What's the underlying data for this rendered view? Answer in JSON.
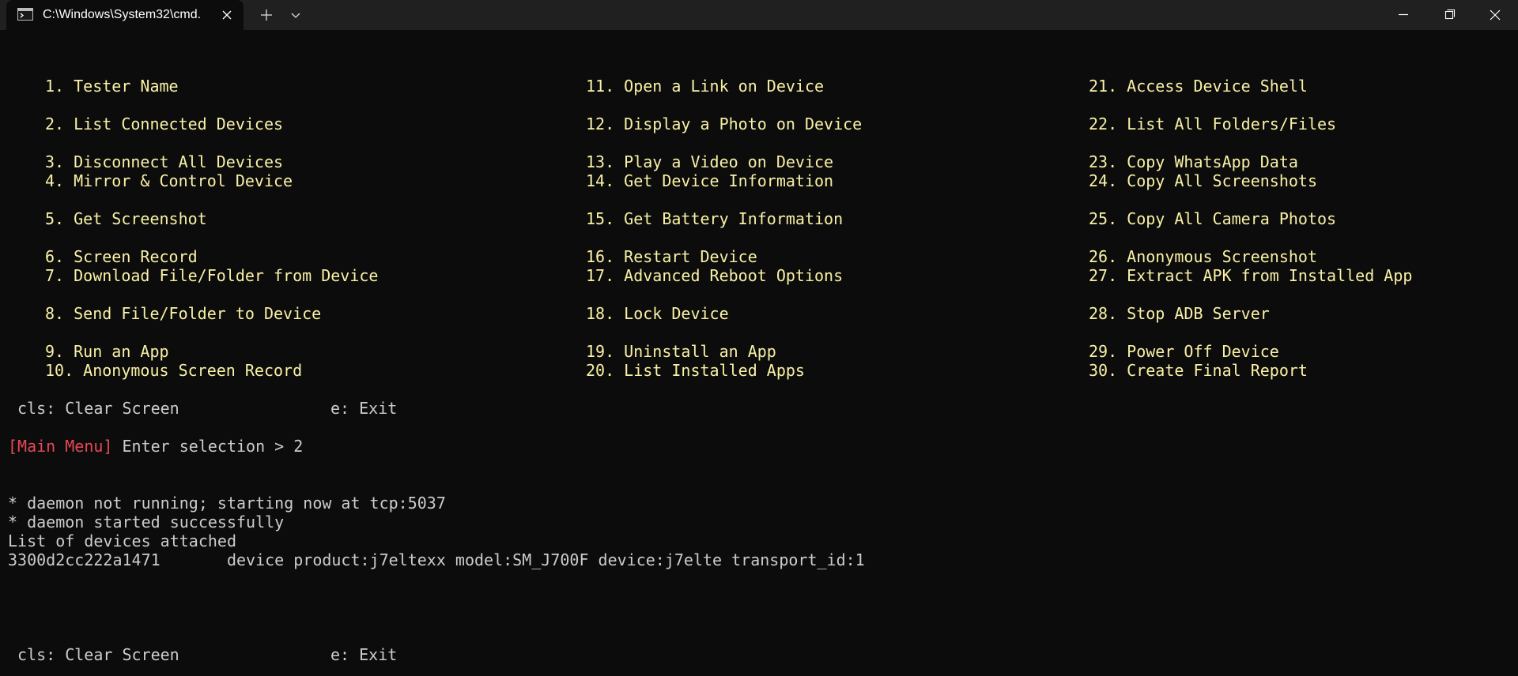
{
  "window": {
    "tab_title": "C:\\Windows\\System32\\cmd.",
    "tab_icon": "terminal-icon"
  },
  "menu": {
    "col1": [
      {
        "num": "1.",
        "label": "Tester Name"
      },
      {
        "num": "2.",
        "label": "List Connected Devices"
      },
      {
        "num": "3.",
        "label": "Disconnect All Devices"
      },
      {
        "num": "4.",
        "label": "Mirror & Control Device"
      },
      {
        "num": "5.",
        "label": "Get Screenshot"
      },
      {
        "num": "6.",
        "label": "Screen Record"
      },
      {
        "num": "7.",
        "label": "Download File/Folder from Device"
      },
      {
        "num": "8.",
        "label": "Send File/Folder to Device"
      },
      {
        "num": "9.",
        "label": "Run an App"
      },
      {
        "num": "10.",
        "label": "Anonymous Screen Record"
      }
    ],
    "col2": [
      {
        "num": "11.",
        "label": "Open a Link on Device"
      },
      {
        "num": "12.",
        "label": "Display a Photo on Device"
      },
      {
        "num": "13.",
        "label": "Play a Video on Device"
      },
      {
        "num": "14.",
        "label": "Get Device Information"
      },
      {
        "num": "15.",
        "label": "Get Battery Information"
      },
      {
        "num": "16.",
        "label": "Restart Device"
      },
      {
        "num": "17.",
        "label": "Advanced Reboot Options"
      },
      {
        "num": "18.",
        "label": "Lock Device"
      },
      {
        "num": "19.",
        "label": "Uninstall an App"
      },
      {
        "num": "20.",
        "label": "List Installed Apps"
      }
    ],
    "col3": [
      {
        "num": "21.",
        "label": "Access Device Shell"
      },
      {
        "num": "22.",
        "label": "List All Folders/Files"
      },
      {
        "num": "23.",
        "label": "Copy WhatsApp Data"
      },
      {
        "num": "24.",
        "label": "Copy All Screenshots"
      },
      {
        "num": "25.",
        "label": "Copy All Camera Photos"
      },
      {
        "num": "26.",
        "label": "Anonymous Screenshot"
      },
      {
        "num": "27.",
        "label": "Extract APK from Installed App"
      },
      {
        "num": "28.",
        "label": "Stop ADB Server"
      },
      {
        "num": "29.",
        "label": "Power Off Device"
      },
      {
        "num": "30.",
        "label": "Create Final Report"
      }
    ]
  },
  "footer_top": {
    "cls": "cls: Clear Screen",
    "exit": "e: Exit"
  },
  "prompt": {
    "tag": "[Main Menu]",
    "text": " Enter selection > 2"
  },
  "output": [
    "* daemon not running; starting now at tcp:5037",
    "* daemon started successfully",
    "List of devices attached",
    "3300d2cc222a1471       device product:j7eltexx model:SM_J700F device:j7elte transport_id:1"
  ],
  "footer_bottom": {
    "cls": "cls: Clear Screen",
    "exit": "e: Exit"
  },
  "colors": {
    "background": "#0c0c0c",
    "titlebar": "#202020",
    "menu_text": "#f9f1a5",
    "normal_text": "#cccccc",
    "prompt_tag": "#e74856"
  }
}
